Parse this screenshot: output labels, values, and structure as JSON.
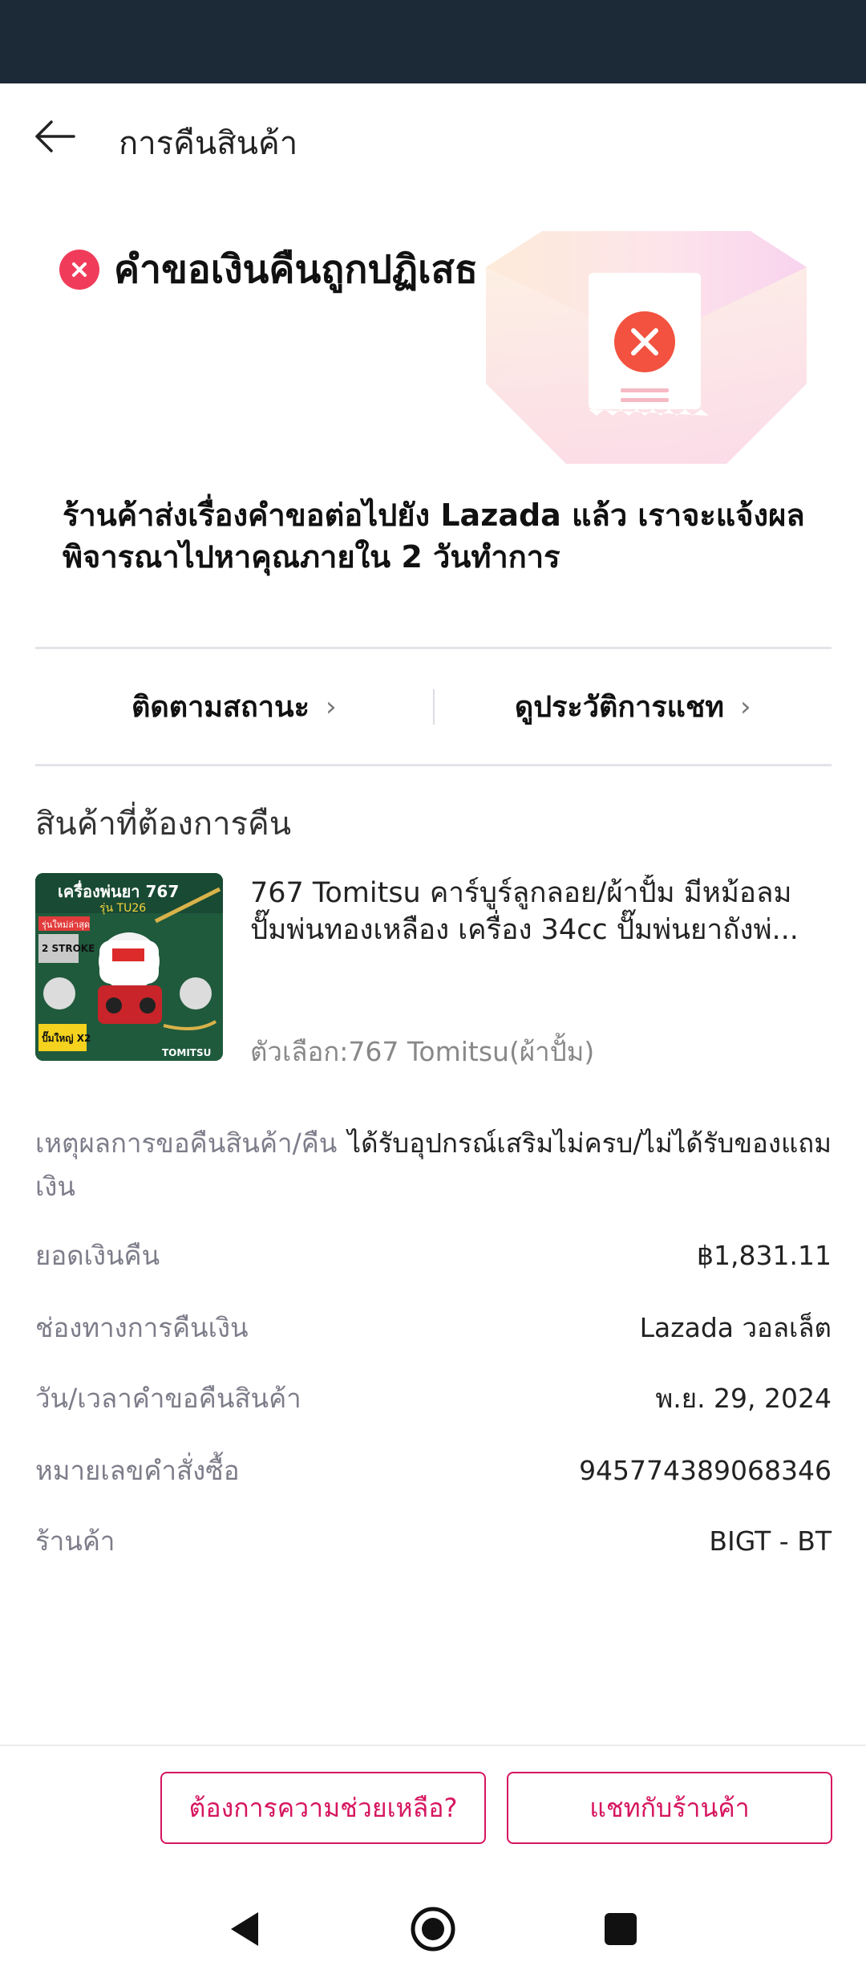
{
  "header": {
    "title": "การคืนสินค้า"
  },
  "status": {
    "title": "คำขอเงินคืนถูกปฏิเสธ",
    "description": "ร้านค้าส่งเรื่องคำขอต่อไปยัง Lazada แล้ว เราจะแจ้งผลพิจารณาไปหาคุณภายใน 2 วันทำการ",
    "accent_color": "#f03c5a"
  },
  "actions": {
    "track_status": "ติดตามสถานะ",
    "chat_history": "ดูประวัติการแชท"
  },
  "section": {
    "title": "สินค้าที่ต้องการคืน"
  },
  "product": {
    "name": "767 Tomitsu คาร์บูร์ลูกลอย/ผ้าปั้ม มีหม้อลม ปั๊มพ่นทองเหลือง เครื่อง 34cc ปั๊มพ่นยาถังพ่...",
    "option": "ตัวเลือก:767 Tomitsu(ผ้าปั้ม)",
    "thumb": {
      "headline": "เครื่องพ่นยา 767",
      "model": "รุ่น TU26",
      "badge_top": "รุ่นใหม่ล่าสุด",
      "badge_strokes": "2 STROKE",
      "badge_pump": "ปั๊มใหญ่ X2",
      "brand": "TOMITSU"
    }
  },
  "details": [
    {
      "label": "เหตุผลการขอคืนสินค้า/คืนเงิน",
      "value": "ได้รับอุปกรณ์เสริมไม่ครบ/ไม่ได้รับของแถม"
    },
    {
      "label": "ยอดเงินคืน",
      "value": "฿1,831.11"
    },
    {
      "label": "ช่องทางการคืนเงิน",
      "value": "Lazada วอลเล็ต"
    },
    {
      "label": "วัน/เวลาคำขอคืนสินค้า",
      "value": "พ.ย. 29, 2024"
    },
    {
      "label": "หมายเลขคำสั่งซื้อ",
      "value": "945774389068346"
    },
    {
      "label": "ร้านค้า",
      "value": "BIGT - BT"
    }
  ],
  "buttons": {
    "help": "ต้องการความช่วยเหลือ?",
    "chat_seller": "แชทกับร้านค้า",
    "brand_color": "#d6165f"
  }
}
